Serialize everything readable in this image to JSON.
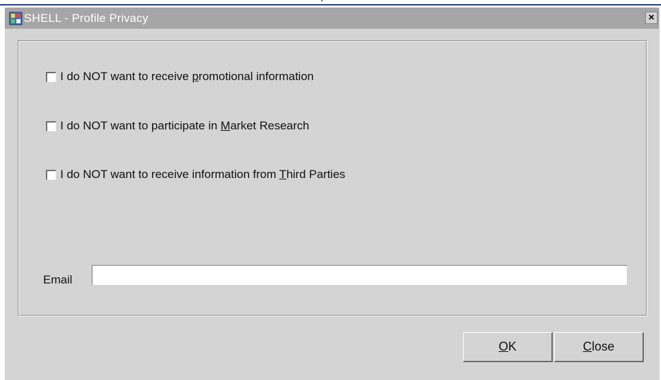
{
  "window": {
    "title": "SHELL - Profile Privacy",
    "close_glyph": "×",
    "app_icon": "app-icon"
  },
  "options": [
    {
      "prefix": "I do NOT want to receive ",
      "mnemonic": "p",
      "suffix": "romotional information",
      "checked": false
    },
    {
      "prefix": "I do NOT want to participate in ",
      "mnemonic": "M",
      "suffix": "arket Research",
      "checked": false
    },
    {
      "prefix": "I do NOT want to receive information from ",
      "mnemonic": "T",
      "suffix": "hird Parties",
      "checked": false
    }
  ],
  "email": {
    "label": "Email",
    "value": ""
  },
  "buttons": {
    "ok": {
      "mnemonic": "O",
      "rest": "K"
    },
    "close": {
      "mnemonic": "C",
      "rest": "lose"
    }
  },
  "colors": {
    "dialog_bg": "#d4d4d4",
    "titlebar_bg": "#a7a7a7",
    "title_text": "#ffffff"
  }
}
